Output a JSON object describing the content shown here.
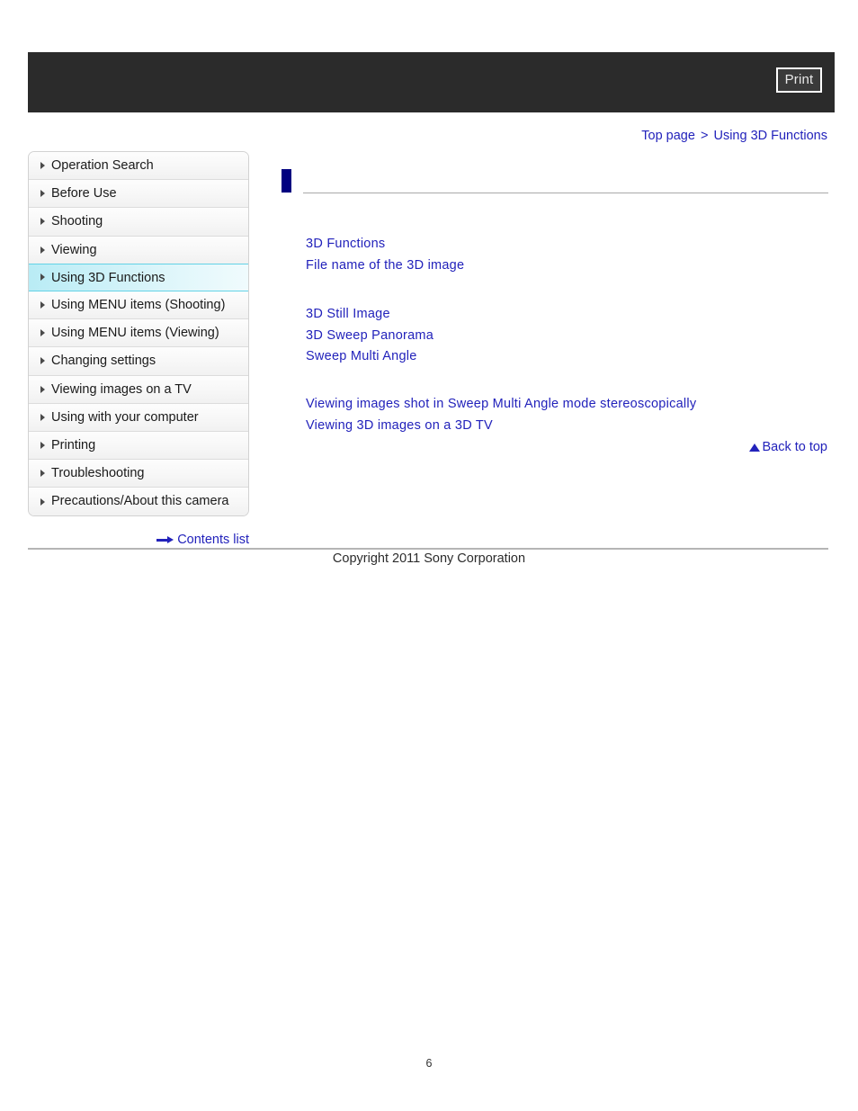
{
  "header": {
    "print_label": "Print"
  },
  "breadcrumb": {
    "top_page": "Top page",
    "separator": ">",
    "current": "Using 3D Functions"
  },
  "sidebar": {
    "items": [
      {
        "label": "Operation Search",
        "active": false
      },
      {
        "label": "Before Use",
        "active": false
      },
      {
        "label": "Shooting",
        "active": false
      },
      {
        "label": "Viewing",
        "active": false
      },
      {
        "label": "Using 3D Functions",
        "active": true
      },
      {
        "label": "Using MENU items (Shooting)",
        "active": false
      },
      {
        "label": "Using MENU items (Viewing)",
        "active": false
      },
      {
        "label": "Changing settings",
        "active": false
      },
      {
        "label": "Viewing images on a TV",
        "active": false
      },
      {
        "label": "Using with your computer",
        "active": false
      },
      {
        "label": "Printing",
        "active": false
      },
      {
        "label": "Troubleshooting",
        "active": false
      },
      {
        "label": "Precautions/About this camera",
        "active": false
      }
    ],
    "contents_list_label": "Contents list"
  },
  "main": {
    "title": "",
    "link_groups": [
      {
        "links": [
          "3D Functions",
          "File name of the 3D image"
        ]
      },
      {
        "links": [
          "3D Still Image",
          "3D Sweep Panorama",
          "Sweep Multi Angle"
        ]
      },
      {
        "links": [
          "Viewing images shot in Sweep Multi Angle mode stereoscopically",
          "Viewing 3D images on a 3D TV"
        ]
      }
    ],
    "back_to_top_label": "Back to top"
  },
  "footer": {
    "copyright": "Copyright 2011 Sony Corporation",
    "page_number": "6"
  },
  "colors": {
    "link_blue": "#2222bb",
    "title_marker_navy": "#000080",
    "active_cyan": "#63d2e6"
  }
}
